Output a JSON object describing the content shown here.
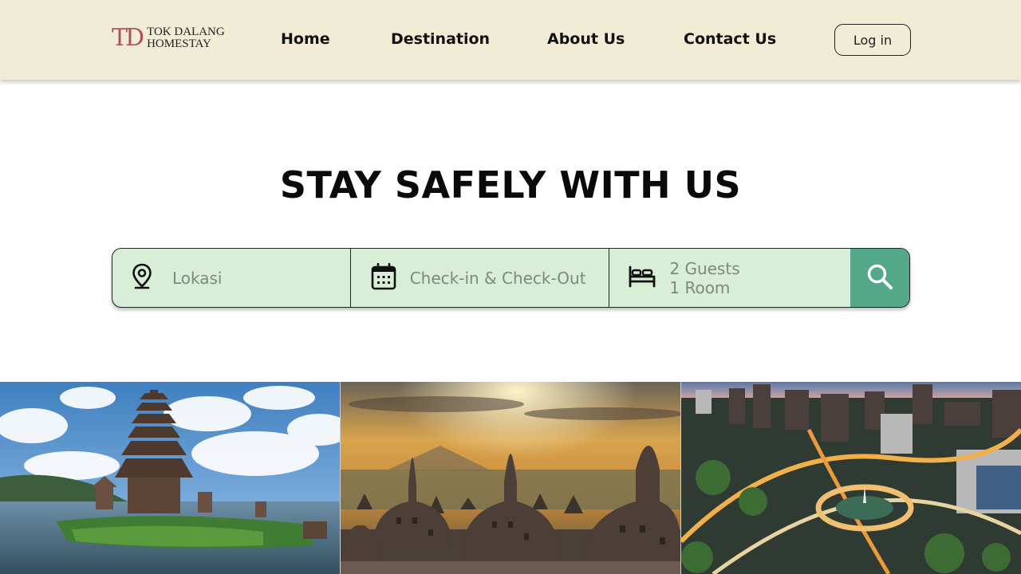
{
  "header": {
    "logo_mark": "TD",
    "logo_line1": "TOK DALANG",
    "logo_line2": "HOMESTAY",
    "nav": [
      {
        "label": "Home"
      },
      {
        "label": "Destination"
      },
      {
        "label": "About Us"
      },
      {
        "label": "Contact Us"
      }
    ],
    "login_label": "Log in"
  },
  "hero": {
    "title": "STAY SAFELY WITH US"
  },
  "search": {
    "location_placeholder": "Lokasi",
    "dates_placeholder": "Check-in & Check-Out",
    "guests_line1": "2 Guests",
    "guests_line2": "1 Room",
    "icons": [
      "location-pin-icon",
      "calendar-icon",
      "bed-icon",
      "search-icon"
    ]
  },
  "gallery": {
    "images": [
      "temple-on-lake-image",
      "stupas-at-sunrise-image",
      "city-roundabout-image"
    ]
  },
  "colors": {
    "header_bg": "#f1ecd6",
    "search_bg": "#d9eed7",
    "search_button": "#53a88a",
    "logo_accent": "#b0505c"
  }
}
